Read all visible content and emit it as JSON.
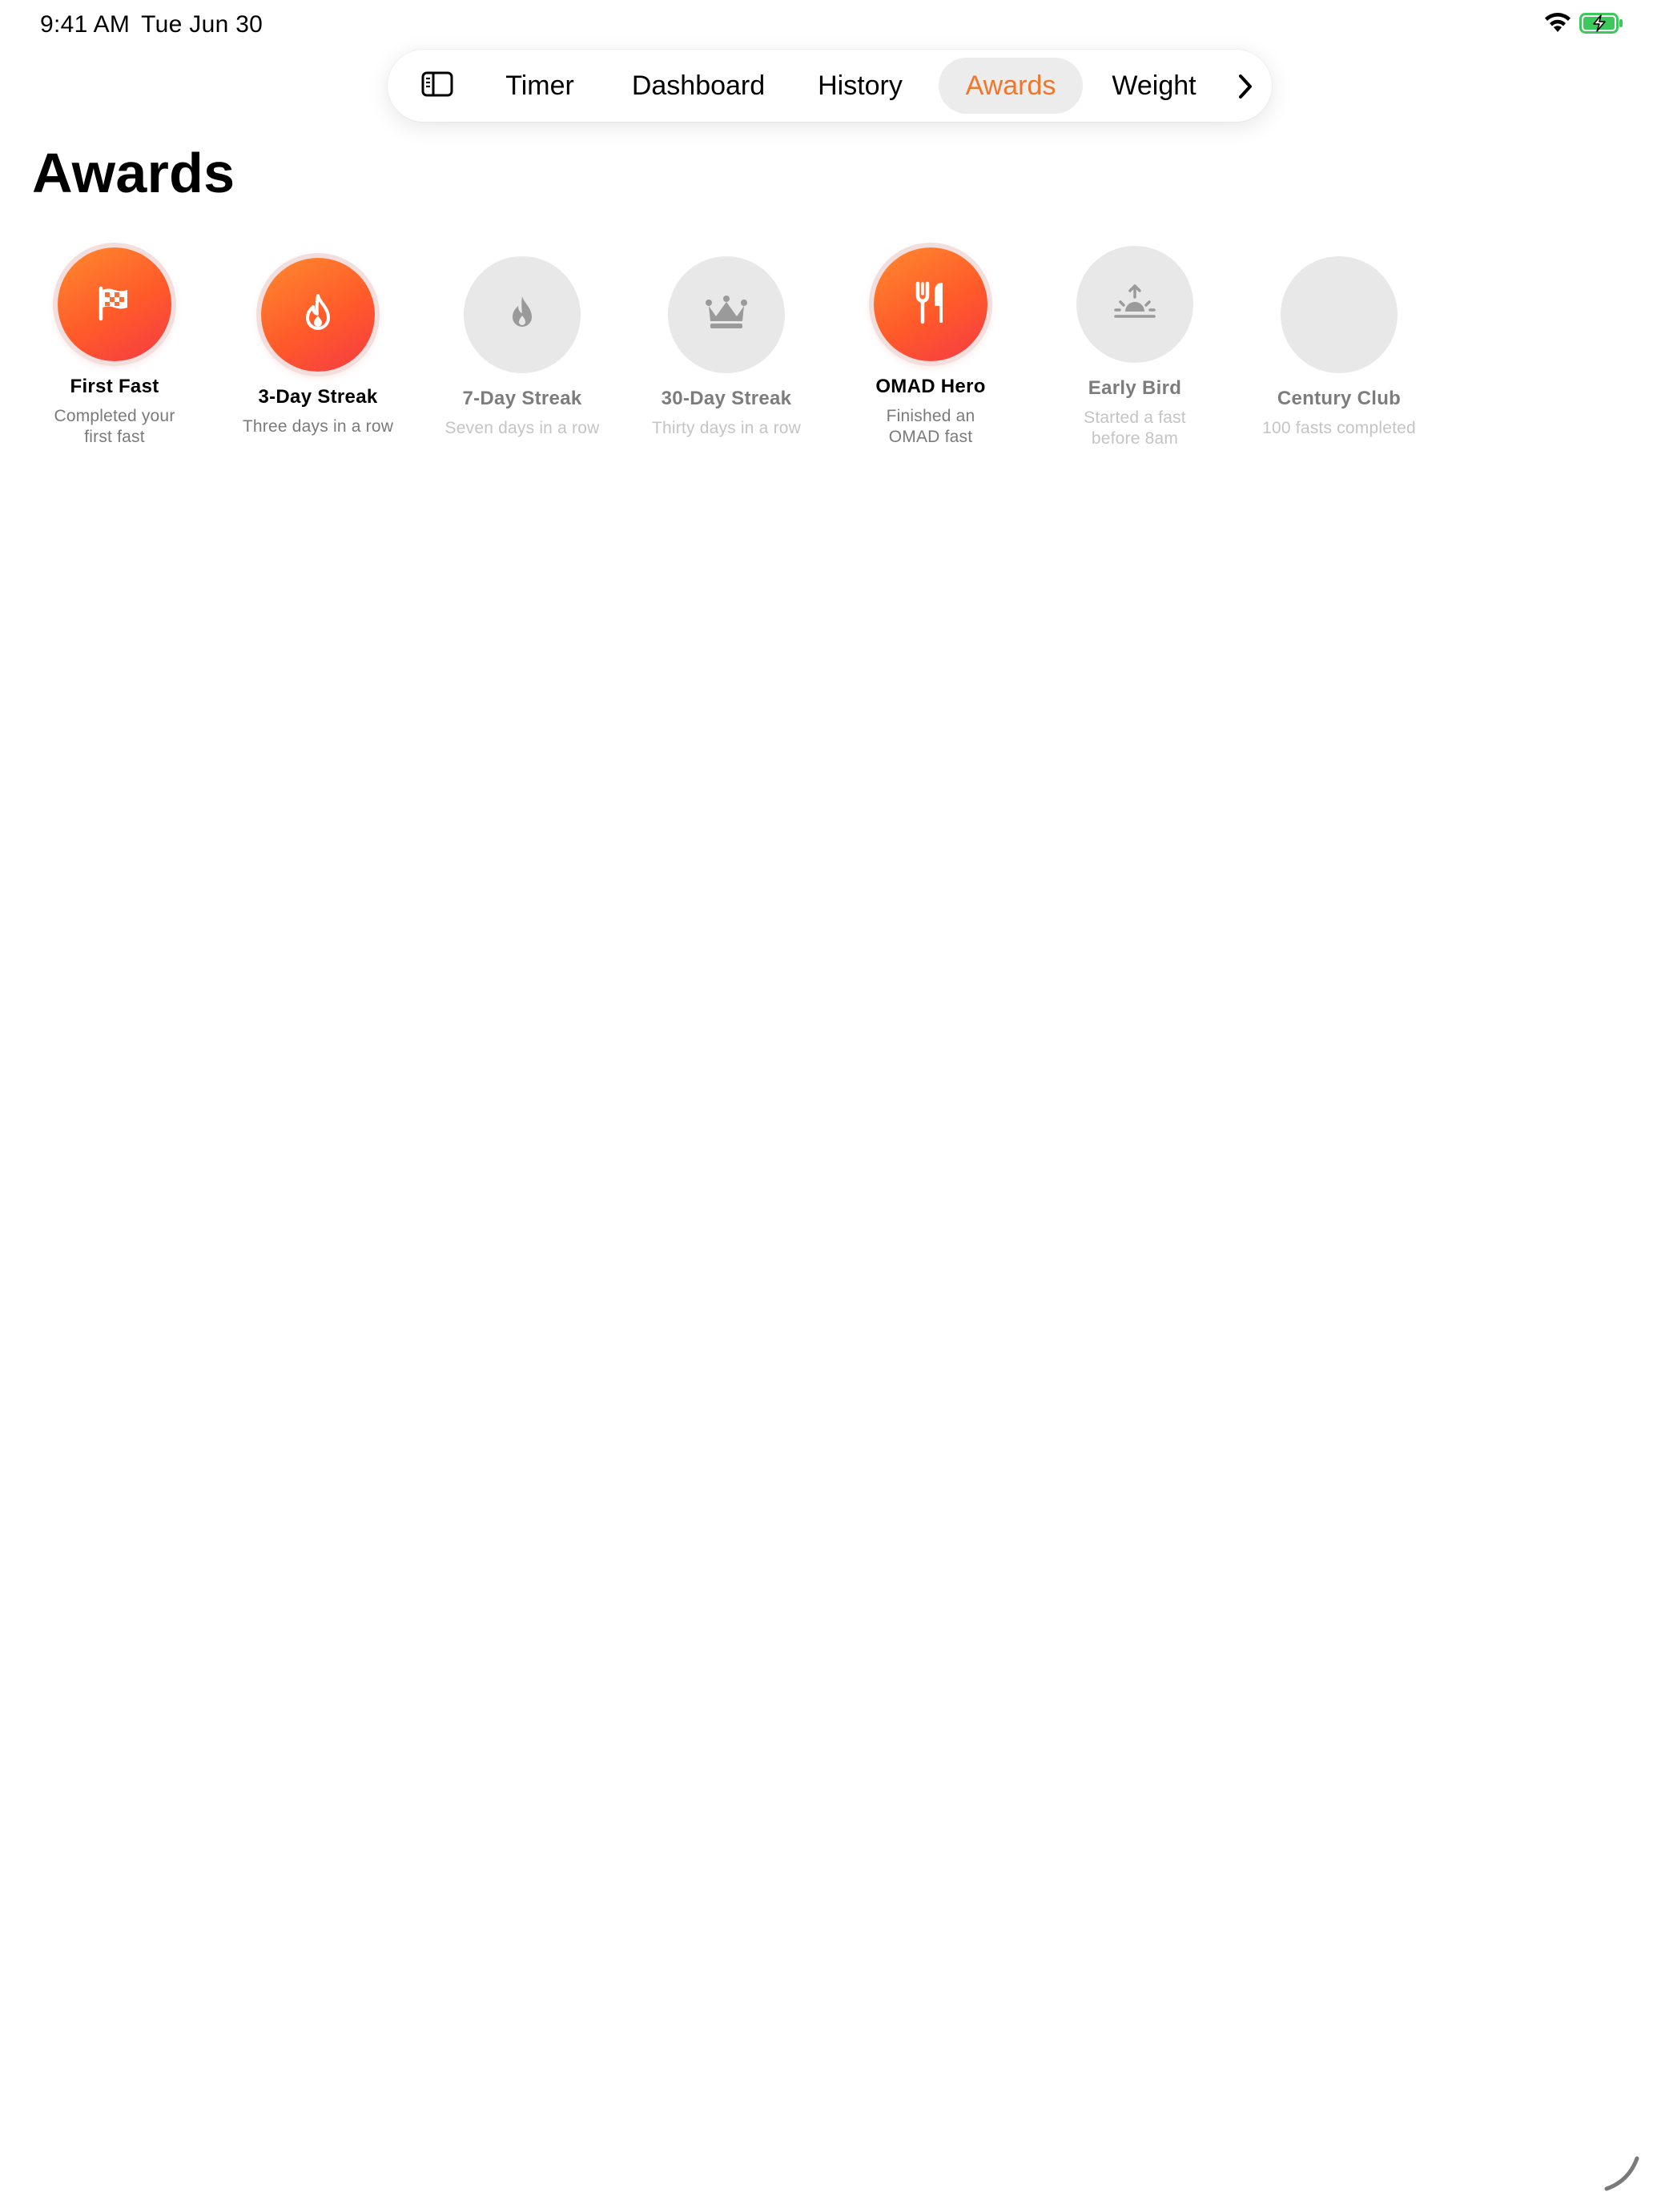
{
  "status_bar": {
    "time": "9:41 AM",
    "date": "Tue Jun 30"
  },
  "tabs": [
    {
      "label": "Timer",
      "active": false
    },
    {
      "label": "Dashboard",
      "active": false
    },
    {
      "label": "History",
      "active": false
    },
    {
      "label": "Awards",
      "active": true
    },
    {
      "label": "Weight",
      "active": false
    }
  ],
  "page": {
    "title": "Awards"
  },
  "accent_color": "#f2762a",
  "awards": [
    {
      "title": "First Fast",
      "description": "Completed your first fast",
      "earned": true,
      "icon": "checkered-flag-icon"
    },
    {
      "title": "3-Day Streak",
      "description": "Three days in a row",
      "earned": true,
      "icon": "flame-icon"
    },
    {
      "title": "7-Day Streak",
      "description": "Seven days in a row",
      "earned": false,
      "icon": "flame-icon"
    },
    {
      "title": "30-Day Streak",
      "description": "Thirty days in a row",
      "earned": false,
      "icon": "crown-icon"
    },
    {
      "title": "OMAD Hero",
      "description": "Finished an OMAD fast",
      "earned": true,
      "icon": "fork-knife-icon"
    },
    {
      "title": "Early Bird",
      "description": "Started a fast before 8am",
      "earned": false,
      "icon": "sunrise-icon"
    },
    {
      "title": "Century Club",
      "description": "100 fasts completed",
      "earned": false,
      "icon": ""
    }
  ]
}
